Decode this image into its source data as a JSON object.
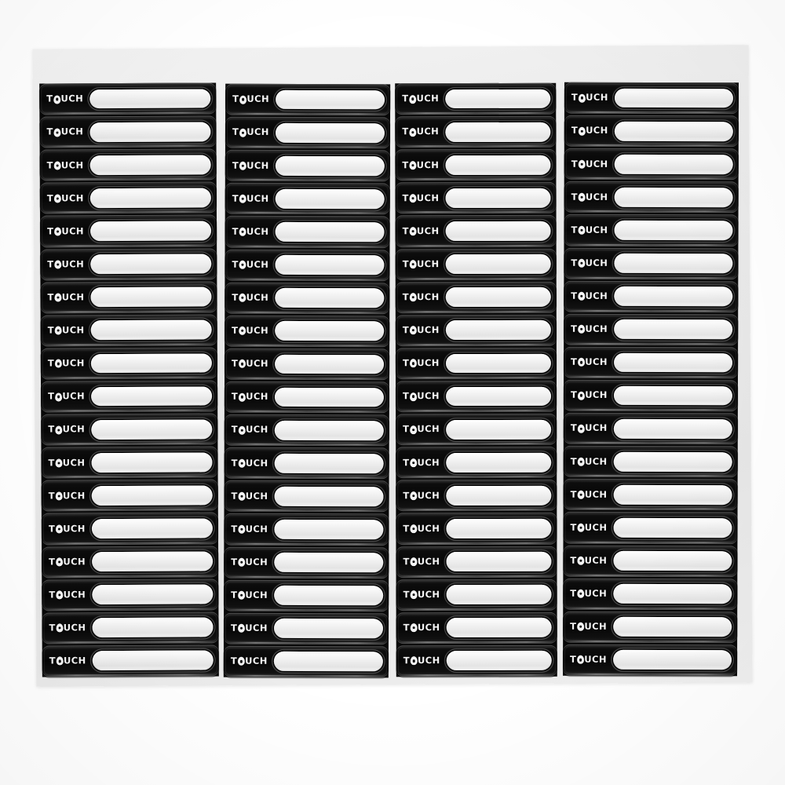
{
  "product": {
    "title": "TOUCH label sticker sheet",
    "brand_text": "TOUCH",
    "brand_letters_before": "T",
    "brand_letter_o": "O",
    "brand_letters_after": "UCH",
    "columns": 4,
    "rows_per_column": 18,
    "total_labels": 72,
    "colors": {
      "background": "#ffffff",
      "backing_sheet": "#ececec",
      "label_body": "#090909",
      "brand_text": "#f4f4f4",
      "write_area": "#e8e8e8",
      "write_area_highlight": "#ffffff"
    }
  },
  "grid": {
    "columns": [
      {
        "id": "column-1",
        "labels": [
          {
            "brand": "TOUCH",
            "write_area": ""
          },
          {
            "brand": "TOUCH",
            "write_area": ""
          },
          {
            "brand": "TOUCH",
            "write_area": ""
          },
          {
            "brand": "TOUCH",
            "write_area": ""
          },
          {
            "brand": "TOUCH",
            "write_area": ""
          },
          {
            "brand": "TOUCH",
            "write_area": ""
          },
          {
            "brand": "TOUCH",
            "write_area": ""
          },
          {
            "brand": "TOUCH",
            "write_area": ""
          },
          {
            "brand": "TOUCH",
            "write_area": ""
          },
          {
            "brand": "TOUCH",
            "write_area": ""
          },
          {
            "brand": "TOUCH",
            "write_area": ""
          },
          {
            "brand": "TOUCH",
            "write_area": ""
          },
          {
            "brand": "TOUCH",
            "write_area": ""
          },
          {
            "brand": "TOUCH",
            "write_area": ""
          },
          {
            "brand": "TOUCH",
            "write_area": ""
          },
          {
            "brand": "TOUCH",
            "write_area": ""
          },
          {
            "brand": "TOUCH",
            "write_area": ""
          },
          {
            "brand": "TOUCH",
            "write_area": ""
          }
        ]
      },
      {
        "id": "column-2",
        "labels": [
          {
            "brand": "TOUCH",
            "write_area": ""
          },
          {
            "brand": "TOUCH",
            "write_area": ""
          },
          {
            "brand": "TOUCH",
            "write_area": ""
          },
          {
            "brand": "TOUCH",
            "write_area": ""
          },
          {
            "brand": "TOUCH",
            "write_area": ""
          },
          {
            "brand": "TOUCH",
            "write_area": ""
          },
          {
            "brand": "TOUCH",
            "write_area": ""
          },
          {
            "brand": "TOUCH",
            "write_area": ""
          },
          {
            "brand": "TOUCH",
            "write_area": ""
          },
          {
            "brand": "TOUCH",
            "write_area": ""
          },
          {
            "brand": "TOUCH",
            "write_area": ""
          },
          {
            "brand": "TOUCH",
            "write_area": ""
          },
          {
            "brand": "TOUCH",
            "write_area": ""
          },
          {
            "brand": "TOUCH",
            "write_area": ""
          },
          {
            "brand": "TOUCH",
            "write_area": ""
          },
          {
            "brand": "TOUCH",
            "write_area": ""
          },
          {
            "brand": "TOUCH",
            "write_area": ""
          },
          {
            "brand": "TOUCH",
            "write_area": ""
          }
        ]
      },
      {
        "id": "column-3",
        "labels": [
          {
            "brand": "TOUCH",
            "write_area": ""
          },
          {
            "brand": "TOUCH",
            "write_area": ""
          },
          {
            "brand": "TOUCH",
            "write_area": ""
          },
          {
            "brand": "TOUCH",
            "write_area": ""
          },
          {
            "brand": "TOUCH",
            "write_area": ""
          },
          {
            "brand": "TOUCH",
            "write_area": ""
          },
          {
            "brand": "TOUCH",
            "write_area": ""
          },
          {
            "brand": "TOUCH",
            "write_area": ""
          },
          {
            "brand": "TOUCH",
            "write_area": ""
          },
          {
            "brand": "TOUCH",
            "write_area": ""
          },
          {
            "brand": "TOUCH",
            "write_area": ""
          },
          {
            "brand": "TOUCH",
            "write_area": ""
          },
          {
            "brand": "TOUCH",
            "write_area": ""
          },
          {
            "brand": "TOUCH",
            "write_area": ""
          },
          {
            "brand": "TOUCH",
            "write_area": ""
          },
          {
            "brand": "TOUCH",
            "write_area": ""
          },
          {
            "brand": "TOUCH",
            "write_area": ""
          },
          {
            "brand": "TOUCH",
            "write_area": ""
          }
        ]
      },
      {
        "id": "column-4",
        "labels": [
          {
            "brand": "TOUCH",
            "write_area": ""
          },
          {
            "brand": "TOUCH",
            "write_area": ""
          },
          {
            "brand": "TOUCH",
            "write_area": ""
          },
          {
            "brand": "TOUCH",
            "write_area": ""
          },
          {
            "brand": "TOUCH",
            "write_area": ""
          },
          {
            "brand": "TOUCH",
            "write_area": ""
          },
          {
            "brand": "TOUCH",
            "write_area": ""
          },
          {
            "brand": "TOUCH",
            "write_area": ""
          },
          {
            "brand": "TOUCH",
            "write_area": ""
          },
          {
            "brand": "TOUCH",
            "write_area": ""
          },
          {
            "brand": "TOUCH",
            "write_area": ""
          },
          {
            "brand": "TOUCH",
            "write_area": ""
          },
          {
            "brand": "TOUCH",
            "write_area": ""
          },
          {
            "brand": "TOUCH",
            "write_area": ""
          },
          {
            "brand": "TOUCH",
            "write_area": ""
          },
          {
            "brand": "TOUCH",
            "write_area": ""
          },
          {
            "brand": "TOUCH",
            "write_area": ""
          },
          {
            "brand": "TOUCH",
            "write_area": ""
          }
        ]
      }
    ]
  }
}
